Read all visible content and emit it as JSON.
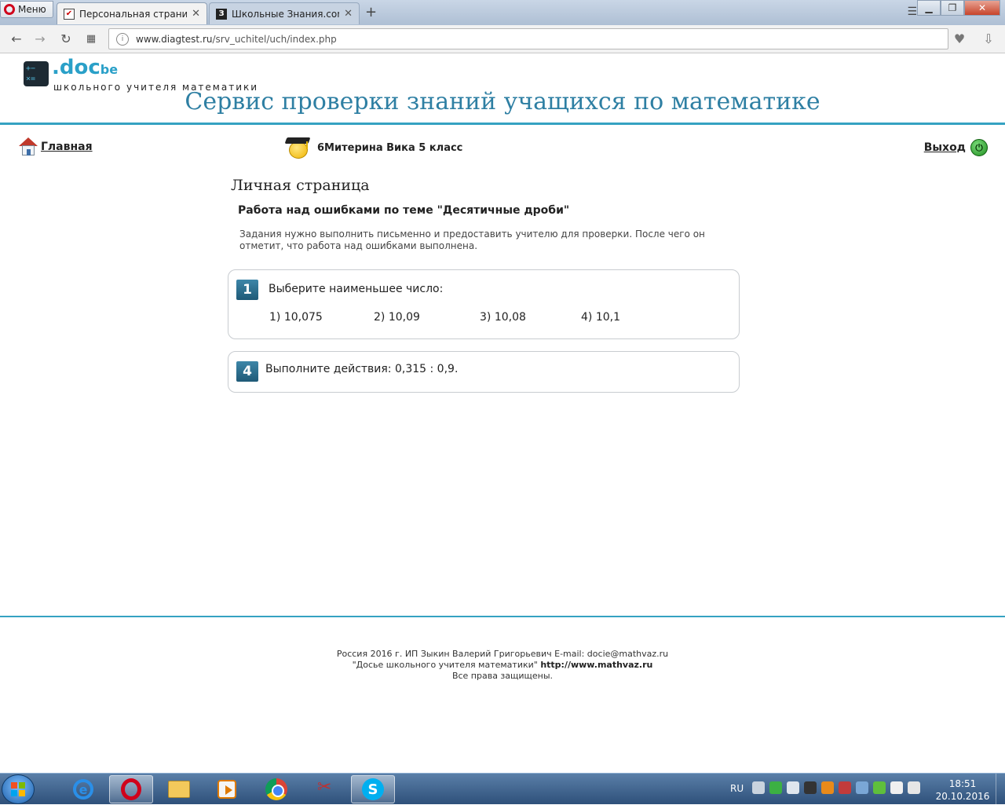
{
  "browser": {
    "menu_label": "Меню",
    "tabs": [
      {
        "title": "Персональная страница у",
        "active": true
      },
      {
        "title": "Школьные Знания.com - ",
        "active": false
      }
    ],
    "url_host": "www.diagtest.ru",
    "url_path": "/srv_uchitel/uch/index.php"
  },
  "site": {
    "logo_doc": ".doc",
    "logo_suffix": "be",
    "logo_subtitle": "школьного учителя математики",
    "title": "Сервис проверки знаний учащихся по математике"
  },
  "nav": {
    "home_label": "Главная",
    "user_label": "6Митерина Вика 5 класс",
    "exit_label": "Выход"
  },
  "content": {
    "heading": "Личная страница",
    "section_title": "Работа над ошибками по теме \"Десятичные дроби\"",
    "instructions": "Задания нужно выполнить письменно и предоставить учителю для проверки. После чего он отметит, что работа над ошибками выполнена.",
    "tasks": [
      {
        "number": "1",
        "question": "Выберите наименьшее число:",
        "answers": [
          "1)  10,075",
          "2) 10,09",
          "3) 10,08",
          "4) 10,1"
        ]
      },
      {
        "number": "4",
        "question": "Выполните действия: 0,315  : 0,9."
      }
    ]
  },
  "footer": {
    "line1": "Россия 2016 г. ИП Зыкин Валерий Григорьевич E-mail: docie@mathvaz.ru",
    "line2_text": "\"Досье школьного учителя математики\" ",
    "line2_link": "http://www.mathvaz.ru",
    "line3": "Все права защищены."
  },
  "taskbar": {
    "lang": "RU",
    "time": "18:51",
    "date": "20.10.2016"
  }
}
